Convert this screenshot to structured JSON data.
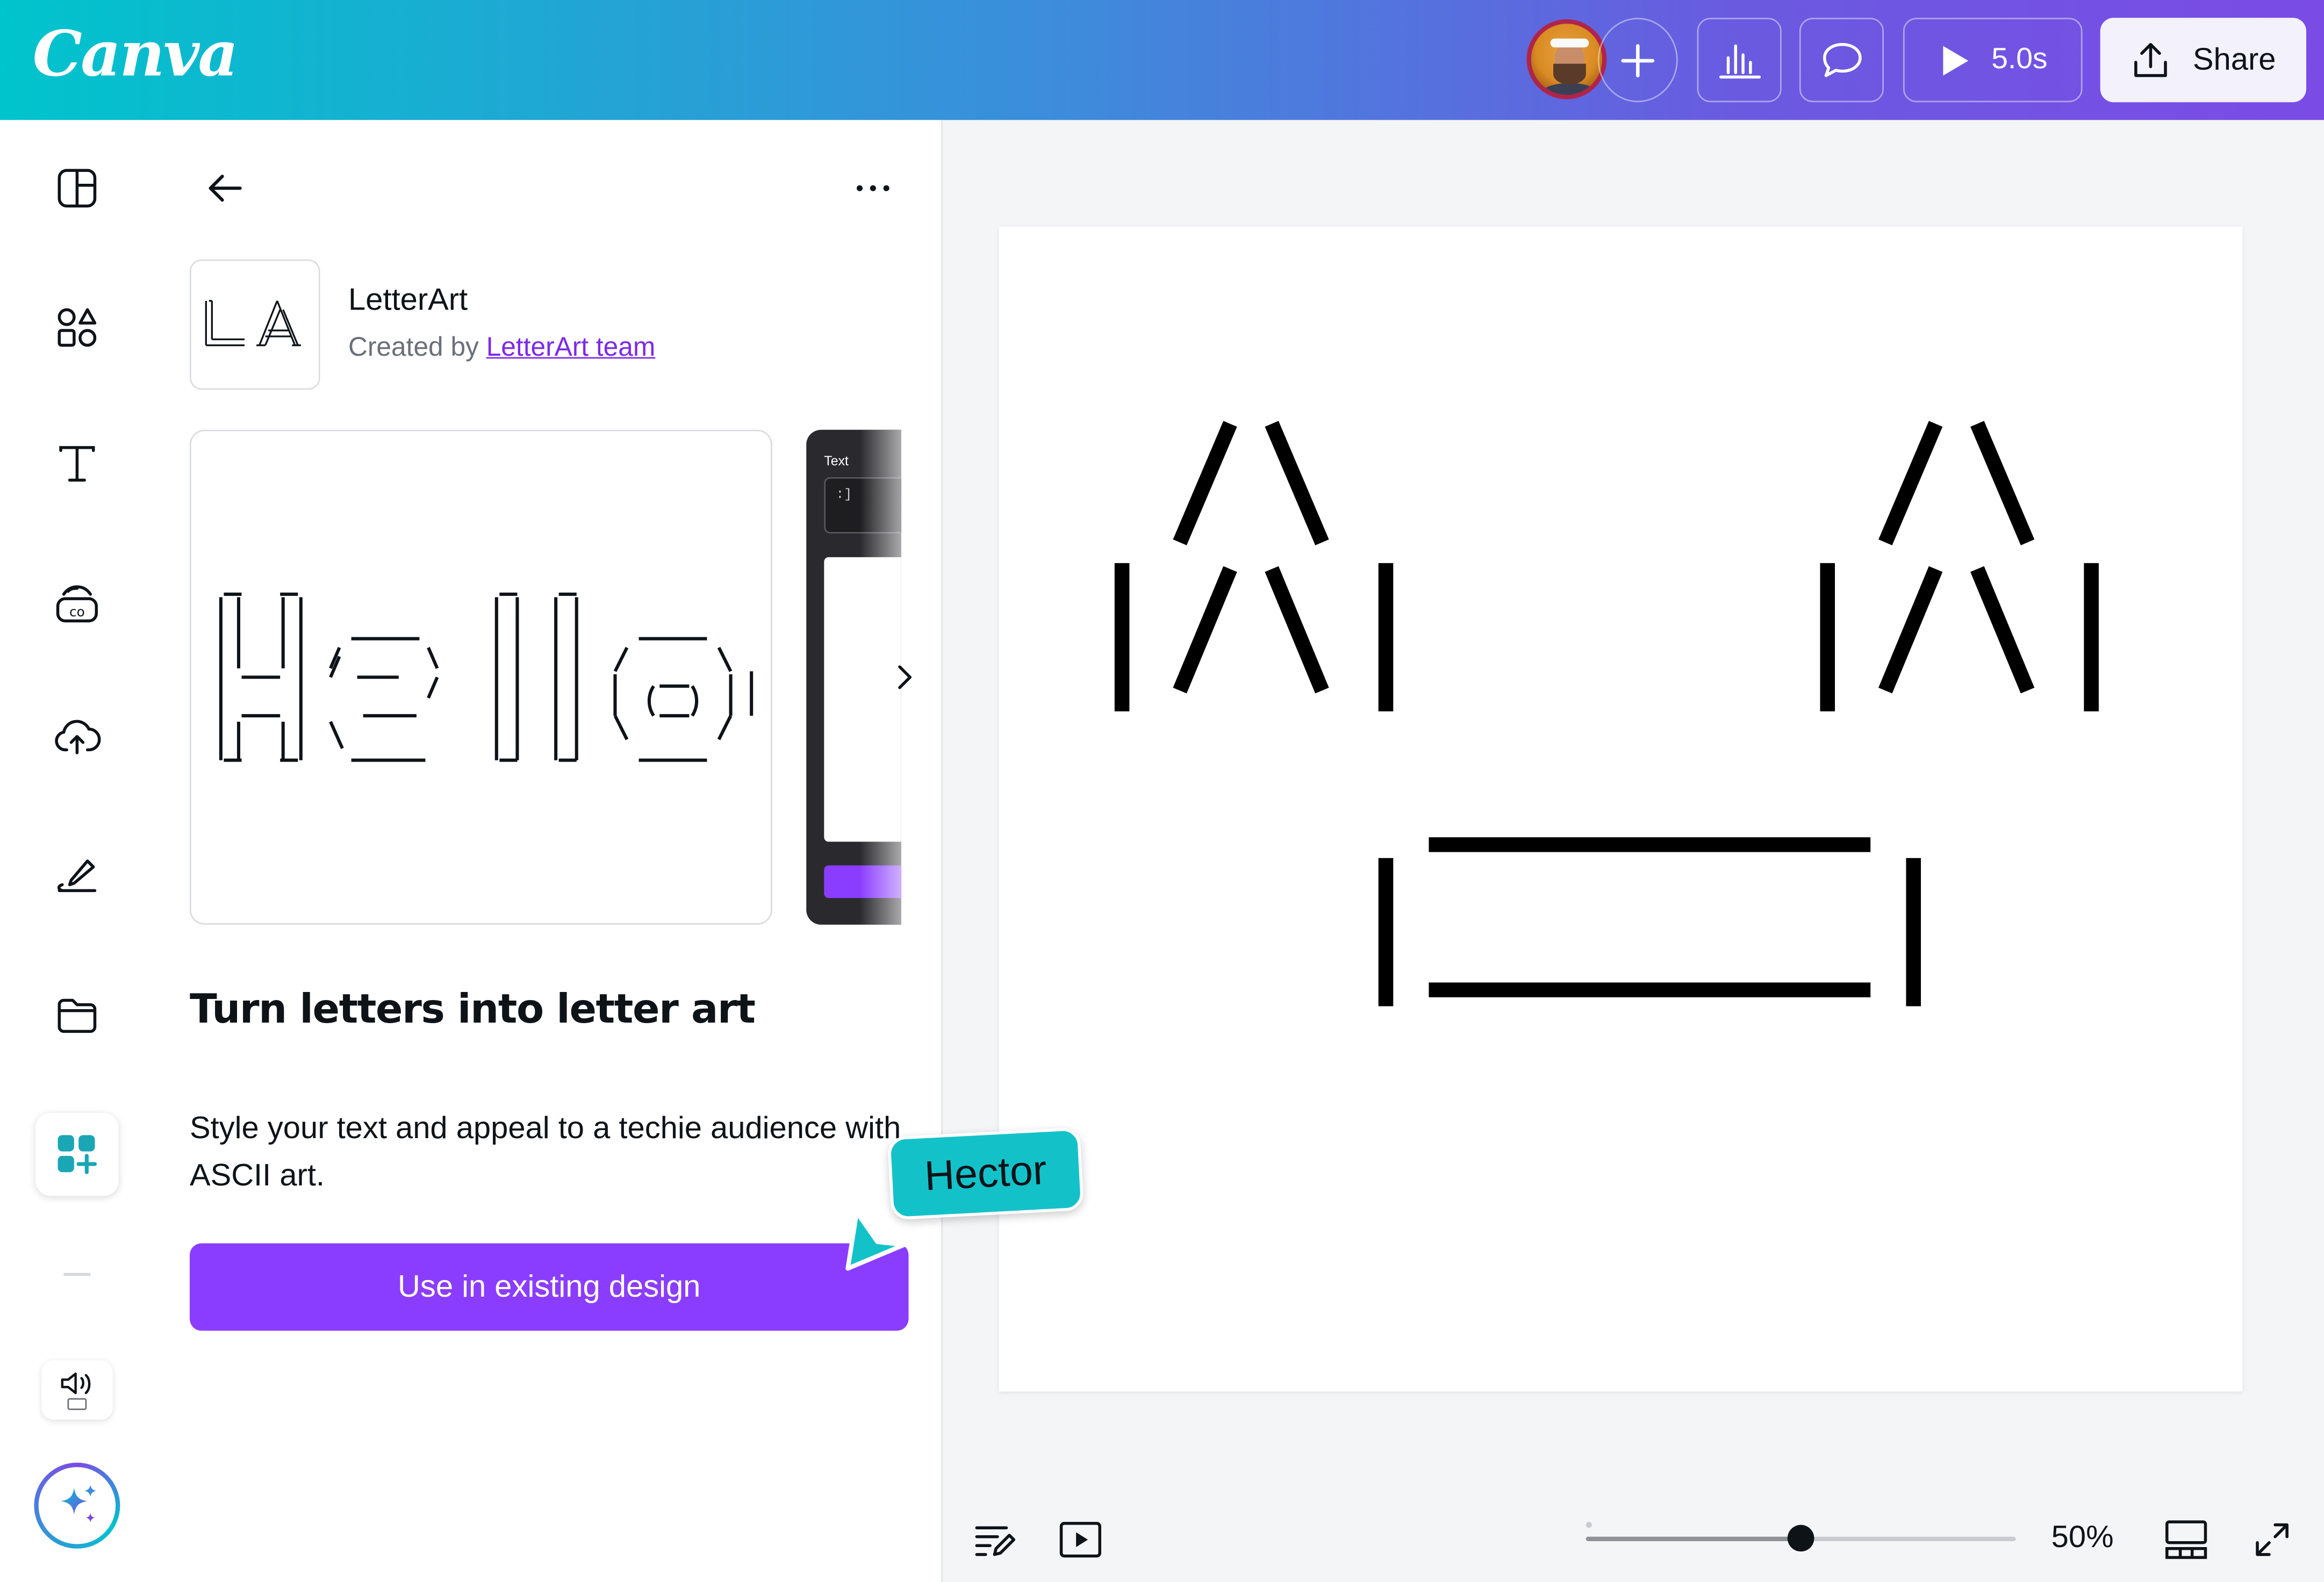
{
  "topbar": {
    "logo": "Canva",
    "duration": "5.0s",
    "share_label": "Share",
    "gradient": [
      "#00c4cc",
      "#7b4be6"
    ]
  },
  "rail": {
    "items": [
      "design-icon",
      "elements-icon",
      "text-icon",
      "brand-icon",
      "uploads-icon",
      "draw-icon",
      "projects-icon",
      "apps-icon"
    ],
    "extra": [
      "captions-icon",
      "magic-icon"
    ]
  },
  "panel": {
    "app_name": "LetterArt",
    "creator_prefix": "Created by ",
    "creator_link": "LetterArt team",
    "preview_label": "Text",
    "preview_field_value": ":]",
    "title": "Turn letters into letter art",
    "description": "Style your text and appeal to a techie audience with ASCII art.",
    "use_button": "Use in existing design"
  },
  "collaborator": {
    "name": "Hector",
    "color": "#13c2c9"
  },
  "zoom": {
    "label": "50%",
    "level": 0.5
  },
  "colors": {
    "accent": "#8b3dff",
    "link": "#7d2ae8"
  }
}
